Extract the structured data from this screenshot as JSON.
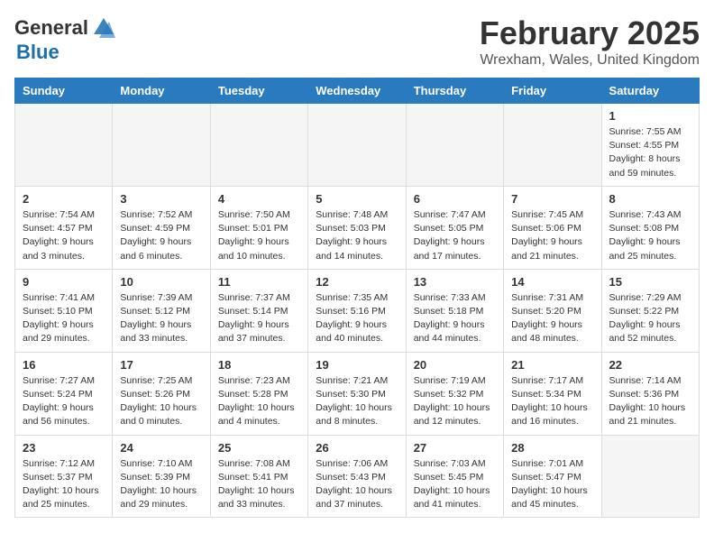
{
  "header": {
    "logo_general": "General",
    "logo_blue": "Blue",
    "month_title": "February 2025",
    "location": "Wrexham, Wales, United Kingdom"
  },
  "days_of_week": [
    "Sunday",
    "Monday",
    "Tuesday",
    "Wednesday",
    "Thursday",
    "Friday",
    "Saturday"
  ],
  "weeks": [
    [
      {
        "day": "",
        "info": ""
      },
      {
        "day": "",
        "info": ""
      },
      {
        "day": "",
        "info": ""
      },
      {
        "day": "",
        "info": ""
      },
      {
        "day": "",
        "info": ""
      },
      {
        "day": "",
        "info": ""
      },
      {
        "day": "1",
        "info": "Sunrise: 7:55 AM\nSunset: 4:55 PM\nDaylight: 8 hours\nand 59 minutes."
      }
    ],
    [
      {
        "day": "2",
        "info": "Sunrise: 7:54 AM\nSunset: 4:57 PM\nDaylight: 9 hours\nand 3 minutes."
      },
      {
        "day": "3",
        "info": "Sunrise: 7:52 AM\nSunset: 4:59 PM\nDaylight: 9 hours\nand 6 minutes."
      },
      {
        "day": "4",
        "info": "Sunrise: 7:50 AM\nSunset: 5:01 PM\nDaylight: 9 hours\nand 10 minutes."
      },
      {
        "day": "5",
        "info": "Sunrise: 7:48 AM\nSunset: 5:03 PM\nDaylight: 9 hours\nand 14 minutes."
      },
      {
        "day": "6",
        "info": "Sunrise: 7:47 AM\nSunset: 5:05 PM\nDaylight: 9 hours\nand 17 minutes."
      },
      {
        "day": "7",
        "info": "Sunrise: 7:45 AM\nSunset: 5:06 PM\nDaylight: 9 hours\nand 21 minutes."
      },
      {
        "day": "8",
        "info": "Sunrise: 7:43 AM\nSunset: 5:08 PM\nDaylight: 9 hours\nand 25 minutes."
      }
    ],
    [
      {
        "day": "9",
        "info": "Sunrise: 7:41 AM\nSunset: 5:10 PM\nDaylight: 9 hours\nand 29 minutes."
      },
      {
        "day": "10",
        "info": "Sunrise: 7:39 AM\nSunset: 5:12 PM\nDaylight: 9 hours\nand 33 minutes."
      },
      {
        "day": "11",
        "info": "Sunrise: 7:37 AM\nSunset: 5:14 PM\nDaylight: 9 hours\nand 37 minutes."
      },
      {
        "day": "12",
        "info": "Sunrise: 7:35 AM\nSunset: 5:16 PM\nDaylight: 9 hours\nand 40 minutes."
      },
      {
        "day": "13",
        "info": "Sunrise: 7:33 AM\nSunset: 5:18 PM\nDaylight: 9 hours\nand 44 minutes."
      },
      {
        "day": "14",
        "info": "Sunrise: 7:31 AM\nSunset: 5:20 PM\nDaylight: 9 hours\nand 48 minutes."
      },
      {
        "day": "15",
        "info": "Sunrise: 7:29 AM\nSunset: 5:22 PM\nDaylight: 9 hours\nand 52 minutes."
      }
    ],
    [
      {
        "day": "16",
        "info": "Sunrise: 7:27 AM\nSunset: 5:24 PM\nDaylight: 9 hours\nand 56 minutes."
      },
      {
        "day": "17",
        "info": "Sunrise: 7:25 AM\nSunset: 5:26 PM\nDaylight: 10 hours\nand 0 minutes."
      },
      {
        "day": "18",
        "info": "Sunrise: 7:23 AM\nSunset: 5:28 PM\nDaylight: 10 hours\nand 4 minutes."
      },
      {
        "day": "19",
        "info": "Sunrise: 7:21 AM\nSunset: 5:30 PM\nDaylight: 10 hours\nand 8 minutes."
      },
      {
        "day": "20",
        "info": "Sunrise: 7:19 AM\nSunset: 5:32 PM\nDaylight: 10 hours\nand 12 minutes."
      },
      {
        "day": "21",
        "info": "Sunrise: 7:17 AM\nSunset: 5:34 PM\nDaylight: 10 hours\nand 16 minutes."
      },
      {
        "day": "22",
        "info": "Sunrise: 7:14 AM\nSunset: 5:36 PM\nDaylight: 10 hours\nand 21 minutes."
      }
    ],
    [
      {
        "day": "23",
        "info": "Sunrise: 7:12 AM\nSunset: 5:37 PM\nDaylight: 10 hours\nand 25 minutes."
      },
      {
        "day": "24",
        "info": "Sunrise: 7:10 AM\nSunset: 5:39 PM\nDaylight: 10 hours\nand 29 minutes."
      },
      {
        "day": "25",
        "info": "Sunrise: 7:08 AM\nSunset: 5:41 PM\nDaylight: 10 hours\nand 33 minutes."
      },
      {
        "day": "26",
        "info": "Sunrise: 7:06 AM\nSunset: 5:43 PM\nDaylight: 10 hours\nand 37 minutes."
      },
      {
        "day": "27",
        "info": "Sunrise: 7:03 AM\nSunset: 5:45 PM\nDaylight: 10 hours\nand 41 minutes."
      },
      {
        "day": "28",
        "info": "Sunrise: 7:01 AM\nSunset: 5:47 PM\nDaylight: 10 hours\nand 45 minutes."
      },
      {
        "day": "",
        "info": ""
      }
    ]
  ]
}
